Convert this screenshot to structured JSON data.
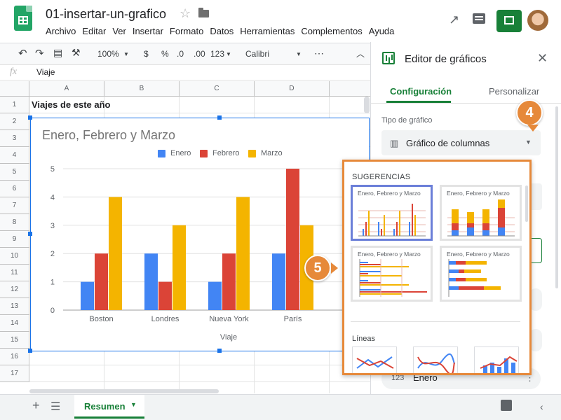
{
  "app": {
    "doc_title": "01-insertar-un-grafico",
    "menu": [
      "Archivo",
      "Editar",
      "Ver",
      "Insertar",
      "Formato",
      "Datos",
      "Herramientas",
      "Complementos",
      "Ayuda"
    ]
  },
  "toolbar": {
    "zoom": "100%",
    "currency": "$",
    "percent": "%",
    "dec_less": ".0",
    "dec_more": ".00",
    "format_more": "123",
    "font": "Calibri",
    "more": "⋯"
  },
  "formula_bar": {
    "fx": "fx",
    "value": "Viaje"
  },
  "sheet": {
    "columns": [
      "A",
      "B",
      "C",
      "D"
    ],
    "rows": [
      "1",
      "2",
      "3",
      "4",
      "5",
      "6",
      "7",
      "8",
      "9",
      "10",
      "11",
      "12",
      "13",
      "14",
      "15",
      "16",
      "17"
    ],
    "a1": "Viajes de este año"
  },
  "chart_data": {
    "type": "bar",
    "title": "Enero, Febrero y Marzo",
    "xlabel": "Viaje",
    "ylabel": "",
    "categories": [
      "Boston",
      "Londres",
      "Nueva York",
      "París"
    ],
    "series": [
      {
        "name": "Enero",
        "values": [
          1,
          2,
          1,
          2
        ],
        "color": "#4285f4"
      },
      {
        "name": "Febrero",
        "values": [
          2,
          1,
          2,
          5
        ],
        "color": "#db4437"
      },
      {
        "name": "Marzo",
        "values": [
          4,
          3,
          4,
          3
        ],
        "color": "#f4b400"
      }
    ],
    "ylim": [
      0,
      5
    ],
    "yticks": [
      "0",
      "1",
      "2",
      "3",
      "4",
      "5"
    ],
    "grid": true,
    "legend": "top"
  },
  "editor": {
    "title": "Editor de gráficos",
    "tabs": [
      "Configuración",
      "Personalizar"
    ],
    "chart_type_label": "Tipo de gráfico",
    "chart_type_value": "Gráfico de columnas",
    "series_value": "Enero",
    "series_icon": "123"
  },
  "popup": {
    "suggestions_label": "SUGERENCIAS",
    "thumb_title": "Enero, Febrero y Marzo",
    "lines_label": "Líneas"
  },
  "badges": {
    "step4": "4",
    "step5": "5"
  },
  "bottom": {
    "sheet_tab": "Resumen"
  }
}
